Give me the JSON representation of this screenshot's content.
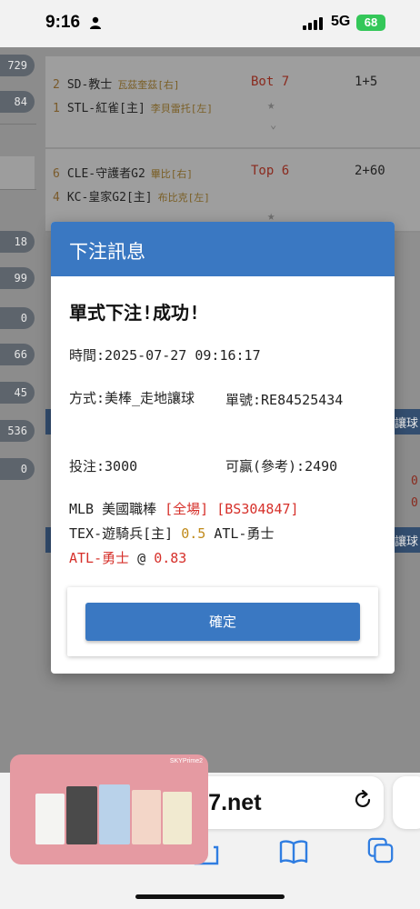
{
  "status_bar": {
    "time": "9:16",
    "network": "5G",
    "battery": "68"
  },
  "side_values": [
    "729",
    "84",
    "18",
    "99",
    "0",
    "66",
    "45",
    "536",
    "0"
  ],
  "games": [
    {
      "away": {
        "num": "2",
        "team": "SD-教士",
        "pitcher": "瓦茲奎茲[右]"
      },
      "home": {
        "num": "1",
        "team": "STL-紅雀[主]",
        "pitcher": "李貝雷托[左]"
      },
      "inning": "Bot 7",
      "score": "1+5"
    },
    {
      "away": {
        "num": "6",
        "team": "CLE-守護者G2",
        "pitcher": "畢比[右]"
      },
      "home": {
        "num": "4",
        "team": "KC-皇家G2[主]",
        "pitcher": "布比克[左]"
      },
      "inning": "Top 6",
      "score": "2+60"
    }
  ],
  "strip_label": "讓球",
  "strip_nums": [
    "0",
    "0"
  ],
  "dialog": {
    "title": "下注訊息",
    "success": "單式下注!成功!",
    "time": "時間:2025-07-27 09:16:17",
    "method": "方式:美棒_走地讓球",
    "order": "單號:RE84525434",
    "stake": "投注:3000",
    "win": "可贏(參考):2490",
    "league": "MLB 美國職棒",
    "period": "[全場]",
    "bet_code": "[BS304847]",
    "home_team": "TEX-遊騎兵[主]",
    "line": "0.5",
    "away_team": "ATL-勇士",
    "pick": "ATL-勇士",
    "at": "@",
    "odds": "0.83",
    "confirm": "確定"
  },
  "safari": {
    "url": "n97.net"
  },
  "pip": {
    "brand": "SKYPrime2"
  },
  "colors": {
    "primary": "#3a78c2",
    "red": "#d6302a",
    "gold": "#c08a1a"
  }
}
